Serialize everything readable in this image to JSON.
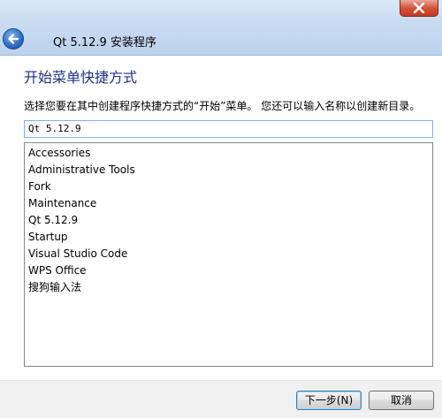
{
  "window": {
    "title": "Qt 5.12.9 安装程序"
  },
  "page": {
    "heading": "开始菜单快捷方式",
    "instruction": "选择您要在其中创建程序快捷方式的“开始”菜单。 您还可以输入名称以创建新目录。"
  },
  "folder_input": {
    "value": "Qt 5.12.9"
  },
  "folders": [
    "Accessories",
    "Administrative Tools",
    "Fork",
    "Maintenance",
    "Qt 5.12.9",
    "Startup",
    "Visual Studio Code",
    "WPS Office",
    "搜狗输入法"
  ],
  "buttons": {
    "next": "下一步(N)",
    "cancel": "取消"
  },
  "icons": {
    "back": "back-arrow-icon",
    "close": "close-icon"
  },
  "colors": {
    "heading": "#1e3287",
    "input_border": "#7eb4ea",
    "close_button": "#c8402a"
  }
}
